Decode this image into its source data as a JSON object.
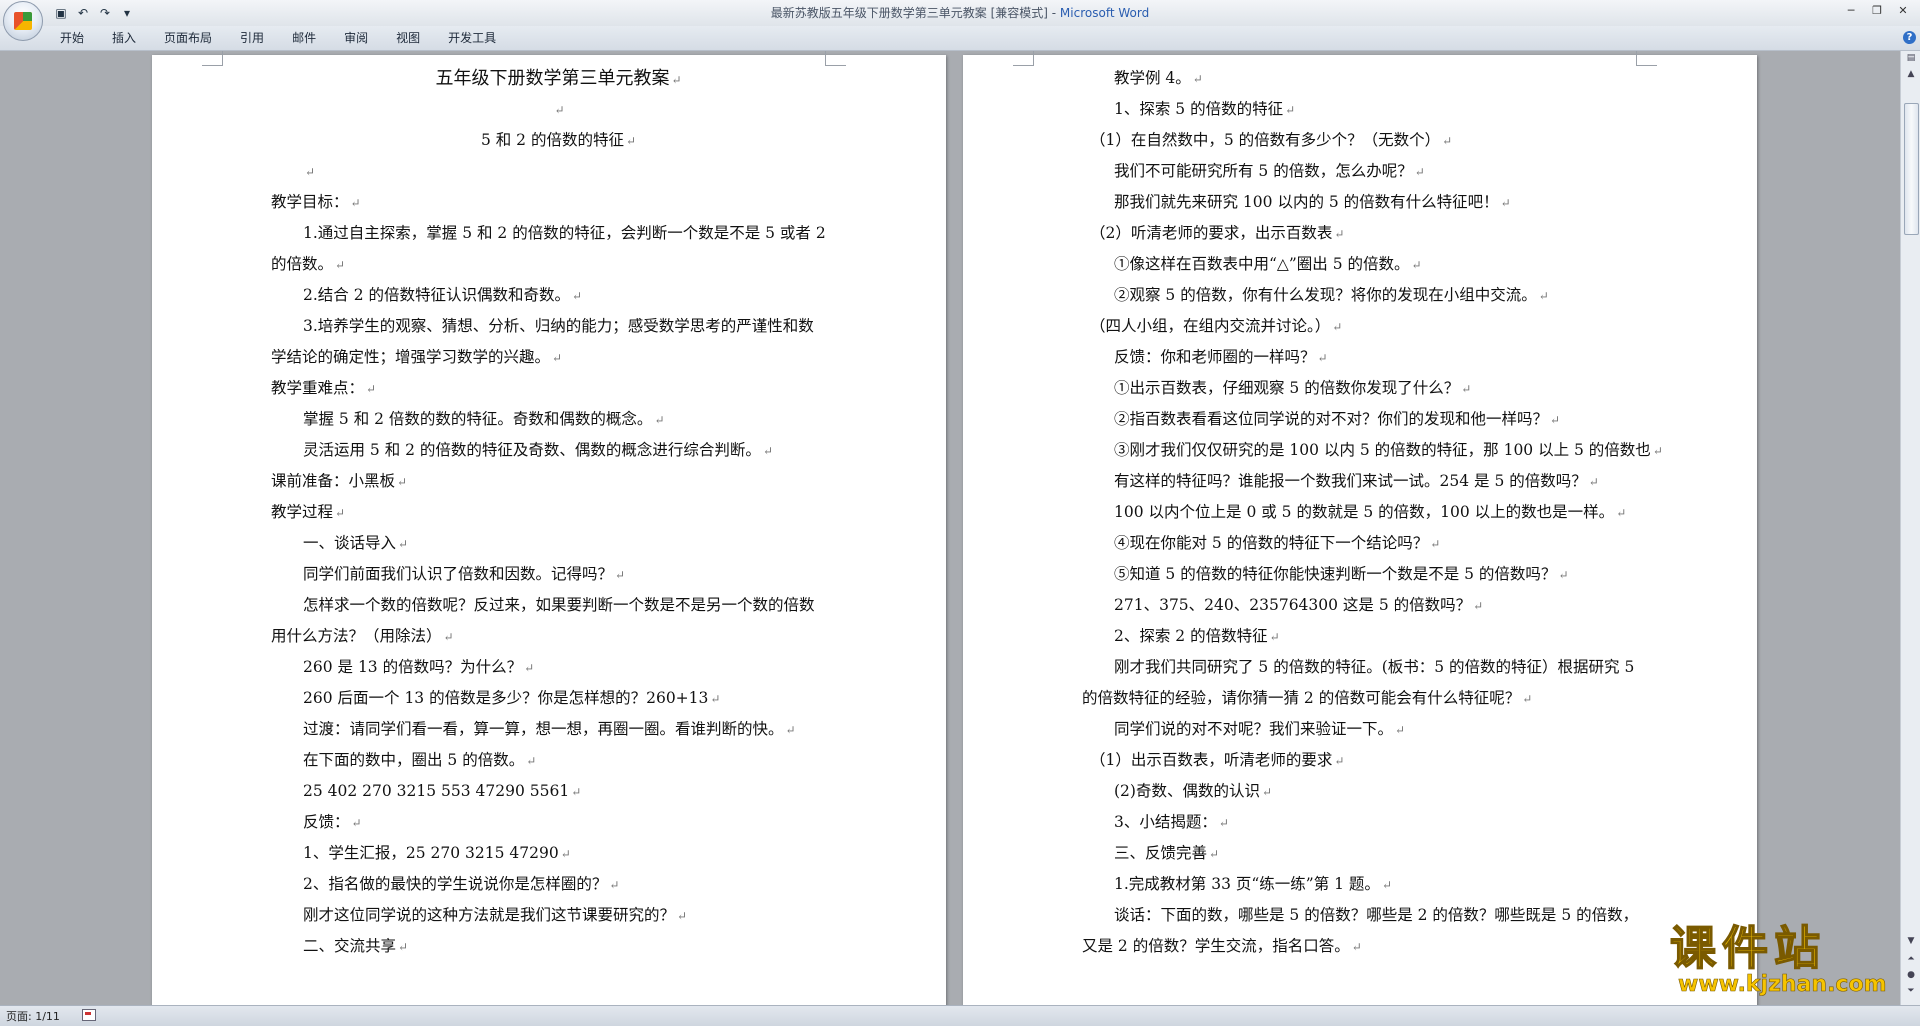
{
  "window": {
    "title": "最新苏教版五年级下册数学第三单元教案 [兼容模式] - ",
    "app_name": "Microsoft Word",
    "qat_icons": [
      "save-icon",
      "undo-icon",
      "redo-icon",
      "customize-icon"
    ]
  },
  "ribbon": {
    "tabs": [
      "开始",
      "插入",
      "页面布局",
      "引用",
      "邮件",
      "审阅",
      "视图",
      "开发工具"
    ]
  },
  "status": {
    "page": "页面: 1/11"
  },
  "watermark": {
    "main": "课件站",
    "url": "www.kjzhan.com"
  },
  "page1": [
    {
      "t": "五年级下册数学第三单元教案",
      "s": "title"
    },
    {
      "t": "",
      "s": "center"
    },
    {
      "t": "5 和 2 的倍数的特征",
      "s": "center"
    },
    {
      "t": "",
      "s": "ind"
    },
    {
      "t": "教学目标：",
      "s": ""
    },
    {
      "t": "1.通过自主探索，掌握 5 和 2 的倍数的特征，会判断一个数是不是 5 或者 2",
      "s": "ind",
      "nopm": true
    },
    {
      "t": "的倍数。",
      "s": ""
    },
    {
      "t": "2.结合 2 的倍数特征认识偶数和奇数。",
      "s": "ind"
    },
    {
      "t": "3.培养学生的观察、猜想、分析、归纳的能力；感受数学思考的严谨性和数",
      "s": "ind",
      "nopm": true
    },
    {
      "t": "学结论的确定性；增强学习数学的兴趣。",
      "s": ""
    },
    {
      "t": "教学重难点：",
      "s": ""
    },
    {
      "t": "掌握 5 和 2 倍数的数的特征。奇数和偶数的概念。",
      "s": "ind"
    },
    {
      "t": "灵活运用 5 和 2 的倍数的特征及奇数、偶数的概念进行综合判断。",
      "s": "ind"
    },
    {
      "t": "课前准备：小黑板",
      "s": ""
    },
    {
      "t": "教学过程",
      "s": ""
    },
    {
      "t": "一、谈话导入",
      "s": "ind"
    },
    {
      "t": "同学们前面我们认识了倍数和因数。记得吗？",
      "s": "ind"
    },
    {
      "t": "怎样求一个数的倍数呢？反过来，如果要判断一个数是不是另一个数的倍数",
      "s": "ind",
      "nopm": true
    },
    {
      "t": "用什么方法？（用除法）",
      "s": ""
    },
    {
      "t": "260 是 13 的倍数吗？为什么？",
      "s": "ind"
    },
    {
      "t": "260 后面一个 13 的倍数是多少？你是怎样想的？260+13",
      "s": "ind"
    },
    {
      "t": "过渡：请同学们看一看，算一算，想一想，再圈一圈。看谁判断的快。",
      "s": "ind"
    },
    {
      "t": "在下面的数中，圈出 5 的倍数。",
      "s": "ind"
    },
    {
      "t": "25    402     270     3215     553     47290      5561",
      "s": "ind"
    },
    {
      "t": "反馈：",
      "s": "ind"
    },
    {
      "t": "1、学生汇报，25     270     3215      47290",
      "s": "ind"
    },
    {
      "t": "2、指名做的最快的学生说说你是怎样圈的？",
      "s": "ind"
    },
    {
      "t": "刚才这位同学说的这种方法就是我们这节课要研究的？",
      "s": "ind"
    },
    {
      "t": "二、交流共享",
      "s": "ind"
    }
  ],
  "page2": [
    {
      "t": "教学例 4。",
      "s": "ind"
    },
    {
      "t": "1、探索 5 的倍数的特征",
      "s": "ind"
    },
    {
      "t": "（1）在自然数中，5 的倍数有多少个？（无数个）",
      "s": "ind-s"
    },
    {
      "t": "我们不可能研究所有 5 的倍数，怎么办呢？",
      "s": "ind"
    },
    {
      "t": "那我们就先来研究 100 以内的 5 的倍数有什么特征吧！",
      "s": "ind"
    },
    {
      "t": "（2）听清老师的要求，出示百数表",
      "s": "ind-s"
    },
    {
      "t": "①像这样在百数表中用“△”圈出 5 的倍数。",
      "s": "ind"
    },
    {
      "t": "②观察 5 的倍数，你有什么发现？将你的发现在小组中交流。",
      "s": "ind"
    },
    {
      "t": "（四人小组，在组内交流并讨论。）",
      "s": "ind-s"
    },
    {
      "t": "反馈：你和老师圈的一样吗？",
      "s": "ind"
    },
    {
      "t": "①出示百数表，仔细观察 5 的倍数你发现了什么？",
      "s": "ind"
    },
    {
      "t": "②指百数表看看这位同学说的对不对？你们的发现和他一样吗？",
      "s": "ind"
    },
    {
      "t": "③刚才我们仅仅研究的是 100 以内 5 的倍数的特征，那 100 以上 5 的倍数也",
      "s": "ind"
    },
    {
      "t": "有这样的特征吗？谁能报一个数我们来试一试。254 是 5 的倍数吗？",
      "s": "ind"
    },
    {
      "t": "100 以内个位上是 0 或 5 的数就是 5 的倍数，100 以上的数也是一样。",
      "s": "ind"
    },
    {
      "t": "④现在你能对 5 的倍数的特征下一个结论吗？",
      "s": "ind"
    },
    {
      "t": "⑤知道 5 的倍数的特征你能快速判断一个数是不是 5 的倍数吗？",
      "s": "ind"
    },
    {
      "t": "271、375、240、235764300 这是 5 的倍数吗？",
      "s": "ind"
    },
    {
      "t": "2、探索 2 的倍数特征",
      "s": "ind"
    },
    {
      "t": "刚才我们共同研究了 5 的倍数的特征。(板书：5 的倍数的特征）根据研究 5",
      "s": "ind",
      "nopm": true
    },
    {
      "t": "的倍数特征的经验，请你猜一猜 2 的倍数可能会有什么特征呢？",
      "s": ""
    },
    {
      "t": "同学们说的对不对呢？我们来验证一下。",
      "s": "ind"
    },
    {
      "t": "（1）出示百数表，听清老师的要求",
      "s": "ind-s"
    },
    {
      "t": "(2)奇数、偶数的认识",
      "s": "ind"
    },
    {
      "t": "3、小结揭题：",
      "s": "ind"
    },
    {
      "t": "三、反馈完善",
      "s": "ind"
    },
    {
      "t": "1.完成教材第 33 页“练一练”第 1 题。",
      "s": "ind"
    },
    {
      "t": "谈话：下面的数，哪些是 5 的倍数？哪些是 2 的倍数？哪些既是 5 的倍数，",
      "s": "ind",
      "nopm": true
    },
    {
      "t": "又是 2 的倍数？学生交流，指名口答。",
      "s": ""
    }
  ]
}
